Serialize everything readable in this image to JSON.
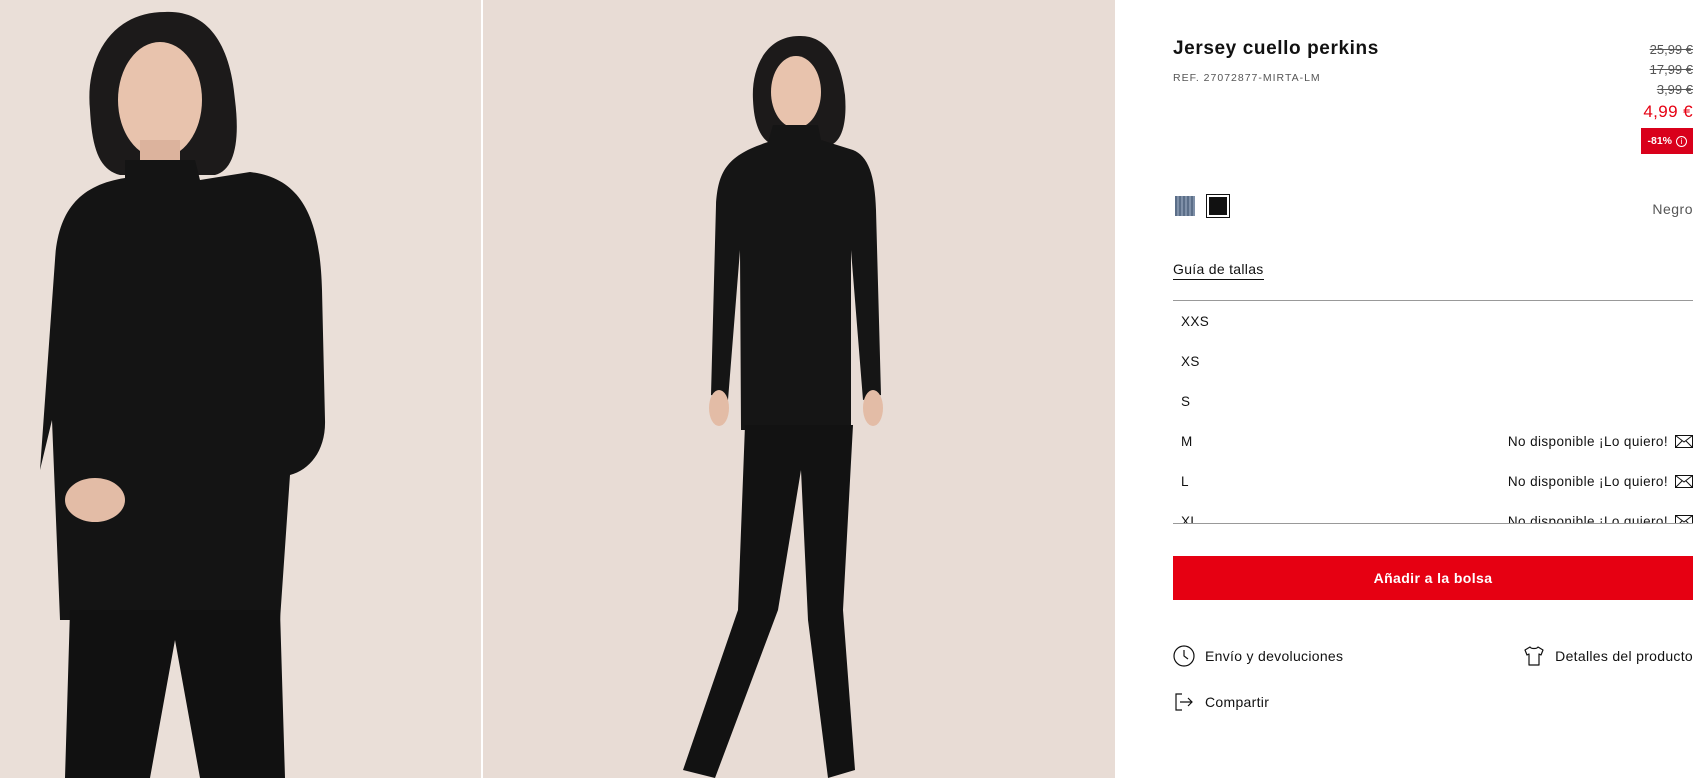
{
  "gallery": {
    "images": [
      {
        "alt": "model-closeup-icon"
      },
      {
        "alt": "model-fullbody-icon"
      }
    ]
  },
  "product": {
    "title": "Jersey cuello perkins",
    "ref": "REF. 27072877-MIRTA-LM",
    "old_prices": [
      "25,99 €",
      "17,99 €",
      "3,99 €"
    ],
    "price": "4,99 €",
    "discount": "-81%",
    "discount_info_icon": "i",
    "colors": [
      {
        "name": "blue-swatch",
        "hex": "#6b7e98"
      },
      {
        "name": "black-swatch",
        "hex": "#111111",
        "selected": true
      }
    ],
    "selected_color": "Negro",
    "size_guide": "Guía de tallas",
    "sizes": [
      {
        "label": "XXS",
        "status": ""
      },
      {
        "label": "XS",
        "status": ""
      },
      {
        "label": "S",
        "status": ""
      },
      {
        "label": "M",
        "status": "No disponible ¡Lo quiero!"
      },
      {
        "label": "L",
        "status": "No disponible ¡Lo quiero!"
      },
      {
        "label": "XL",
        "status": "No disponible ¡Lo quiero!"
      }
    ],
    "add_to_bag": "Añadir a la bolsa",
    "links": {
      "shipping": "Envío y devoluciones",
      "details": "Detalles del producto",
      "share": "Compartir"
    }
  },
  "colors": {
    "accent_red": "#e60012",
    "badge_red": "#d9001b",
    "photo_bg": "#e9ddd6"
  }
}
